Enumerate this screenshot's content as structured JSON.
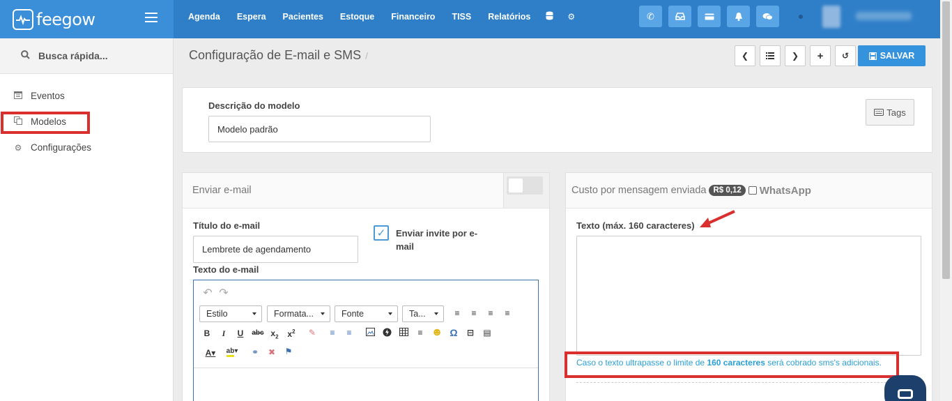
{
  "app": {
    "brand": "feegow"
  },
  "nav": {
    "items": [
      "Agenda",
      "Espera",
      "Pacientes",
      "Estoque",
      "Financeiro",
      "TISS",
      "Relatórios"
    ],
    "database_icon": "database-icon",
    "settings_icon": "gear-icon",
    "quick_buttons": [
      "phone-icon",
      "inbox-icon",
      "card-icon",
      "bell-icon",
      "chat-icon"
    ]
  },
  "sidebar": {
    "search_label": "Busca rápida...",
    "items": [
      {
        "label": "Eventos",
        "icon": "calendar-icon"
      },
      {
        "label": "Modelos",
        "icon": "copy-icon",
        "highlighted": true
      },
      {
        "label": "Configurações",
        "icon": "gears-icon"
      }
    ]
  },
  "header": {
    "title": "Configuração de E-mail e SMS",
    "separator": "/",
    "save_label": "SALVAR"
  },
  "model": {
    "description_label": "Descrição do modelo",
    "description_value": "Modelo padrão",
    "tags_label": "Tags"
  },
  "email": {
    "panel_title": "Enviar e-mail",
    "toggle_on": false,
    "title_label": "Título do e-mail",
    "title_value": "Lembrete de agendamento",
    "invite_label": "Enviar invite por e-mail",
    "invite_checked": true,
    "text_label": "Texto do e-mail",
    "editor": {
      "dropdowns": [
        "Estilo",
        "Formata...",
        "Fonte",
        "Ta..."
      ]
    }
  },
  "sms": {
    "cost_label": "Custo por mensagem enviada",
    "cost_badge": "R$ 0,12",
    "whatsapp_label": "WhatsApp",
    "whatsapp_checked": false,
    "text_label": "Texto (máx. 160 caracteres)",
    "text_value": "",
    "help_prefix": "Caso o texto ultrapasse o limite de",
    "help_bold": "160 caracteres",
    "help_suffix": "será cobrado sms's adicionais."
  },
  "colors": {
    "topbar": "#2f7fc8",
    "brand_bg": "#3b8fd9",
    "save": "#3592dc",
    "annotation_red": "#d9302f",
    "help_text": "#2a9fd6"
  }
}
